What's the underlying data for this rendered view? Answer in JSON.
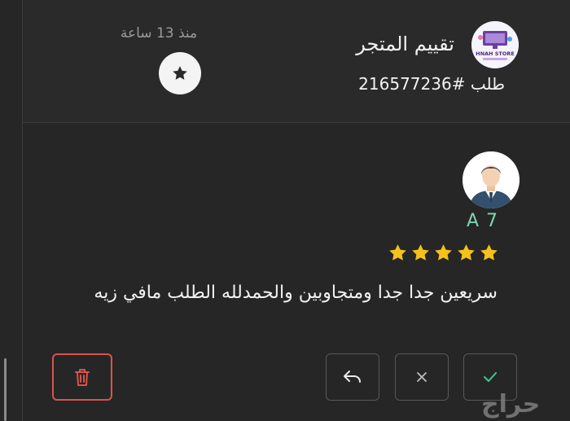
{
  "header": {
    "store_title": "تقييم المتجر",
    "order_number": "طلب #216577236",
    "time_ago": "منذ 13 ساعة",
    "logo_text": "HNAH STORE"
  },
  "review": {
    "reviewer_name": "A 7",
    "rating": 5,
    "rating_max": 5,
    "text": "سريعين جدا جدا ومتجاوبين والحمدلله الطلب مافي زيه"
  },
  "actions": [
    {
      "icon": "trash-icon",
      "color": "#d9534f"
    },
    {
      "icon": "reply-icon"
    },
    {
      "icon": "close-icon"
    },
    {
      "icon": "check-icon",
      "color": "#3ec98f"
    }
  ],
  "watermark": "حراج",
  "colors": {
    "background": "#262626",
    "header": "#2a2a2a",
    "accent_green": "#7fd4b3",
    "star_gold": "#f5c11b",
    "danger": "#d9534f"
  }
}
